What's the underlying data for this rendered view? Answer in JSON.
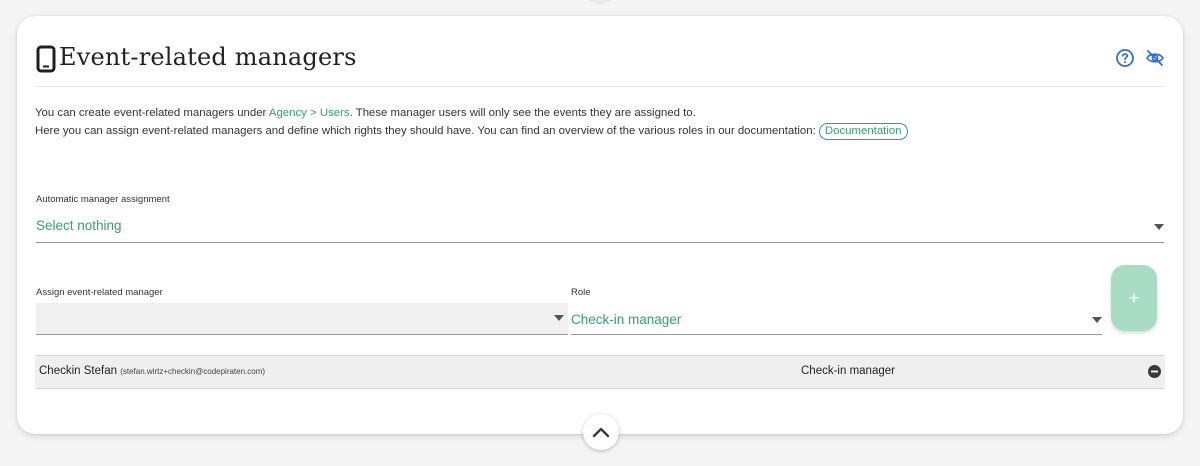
{
  "header": {
    "title": "Event-related managers",
    "title_icon": "mobile-phone-icon",
    "tools": [
      "help-circle-icon",
      "eye-off-icon"
    ]
  },
  "intro": {
    "line1_prefix": "You can create event-related managers under ",
    "line1_link": "Agency > Users",
    "line1_suffix": ". These manager users will only see the events they are assigned to.",
    "line2_text": "Here you can assign event-related managers and define which rights they should have. You can find an overview of the various roles in our documentation:",
    "documentation_label": "Documentation"
  },
  "automatic_assignment": {
    "label": "Automatic manager assignment",
    "value": "Select nothing"
  },
  "assign": {
    "label": "Assign event-related manager",
    "value": ""
  },
  "role": {
    "label": "Role",
    "value": "Check-in manager"
  },
  "add_button": {
    "label": "+"
  },
  "managers": [
    {
      "name": "Checkin Stefan",
      "email": "(stefan.wirtz+checkin@codepiraten.com)",
      "role": "Check-in manager"
    }
  ],
  "colors": {
    "accent": "#2fa36b",
    "add_button": "#a9dcc5",
    "row_background": "#efefef"
  }
}
